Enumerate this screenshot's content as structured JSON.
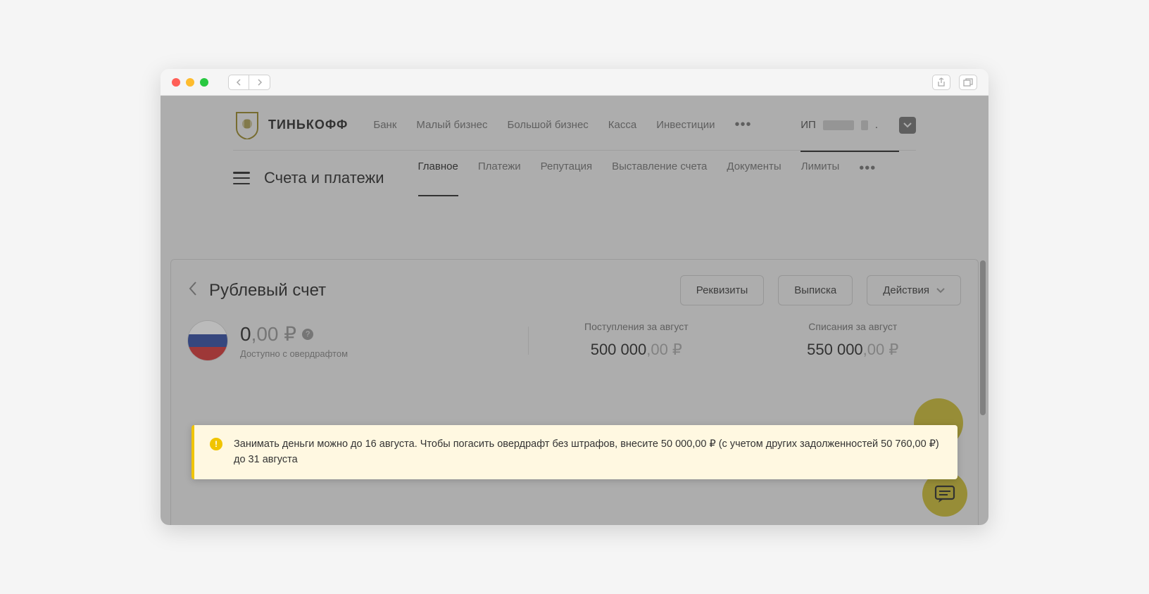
{
  "brand": "ТИНЬКОФФ",
  "topnav": {
    "items": [
      "Банк",
      "Малый бизнес",
      "Большой бизнес",
      "Касса",
      "Инвестиции"
    ],
    "user_prefix": "ИП",
    "user_suffix": "."
  },
  "subnav": {
    "title": "Счета и платежи",
    "tabs": [
      "Главное",
      "Платежи",
      "Репутация",
      "Выставление счета",
      "Документы",
      "Лимиты"
    ],
    "active": 0
  },
  "account": {
    "title": "Рублевый счет",
    "actions": {
      "details": "Реквизиты",
      "statement": "Выписка",
      "more": "Действия"
    },
    "balance_int": "0",
    "balance_dec": ",00 ₽",
    "balance_sub": "Доступно с овердрафтом",
    "stats": [
      {
        "label": "Поступления за август",
        "int": "500 000",
        "dec": ",00 ₽"
      },
      {
        "label": "Списания за август",
        "int": "550 000",
        "dec": ",00 ₽"
      }
    ]
  },
  "alert": {
    "text": "Занимать деньги можно до 16 августа. Чтобы погасить овердрафт без штрафов, внесите 50 000,00 ₽ (с учетом других задолженностей 50 760,00 ₽) до 31 августа"
  }
}
